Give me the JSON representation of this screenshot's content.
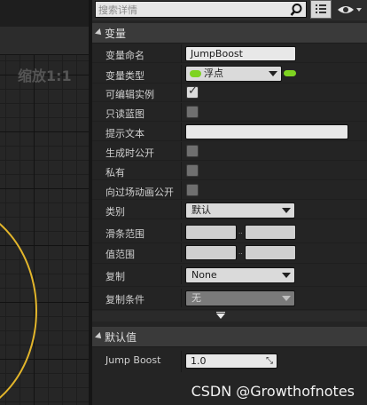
{
  "viewport": {
    "zoom_label": "缩放1:1"
  },
  "search": {
    "placeholder": "搜索详情"
  },
  "variable_category": {
    "title": "变量",
    "rows": [
      {
        "label": "变量命名",
        "value": "JumpBoost"
      },
      {
        "label": "变量类型",
        "value": "浮点"
      },
      {
        "label": "可编辑实例",
        "checked": true
      },
      {
        "label": "只读蓝图",
        "checked": false
      },
      {
        "label": "提示文本",
        "value": ""
      },
      {
        "label": "生成时公开",
        "checked": false
      },
      {
        "label": "私有",
        "checked": false
      },
      {
        "label": "向过场动画公开",
        "checked": false
      },
      {
        "label": "类别",
        "value": "默认"
      },
      {
        "label": "滑条范围"
      },
      {
        "label": "值范围"
      },
      {
        "label": "复制",
        "value": "None"
      },
      {
        "label": "复制条件",
        "value": "无"
      }
    ]
  },
  "default_category": {
    "title": "默认值",
    "rows": [
      {
        "label": "Jump Boost",
        "value": "1.0"
      }
    ]
  },
  "colors": {
    "float_pin": "#7ed321",
    "circle_stroke": "#e3b62b"
  },
  "watermark": "CSDN @Growthofnotes"
}
